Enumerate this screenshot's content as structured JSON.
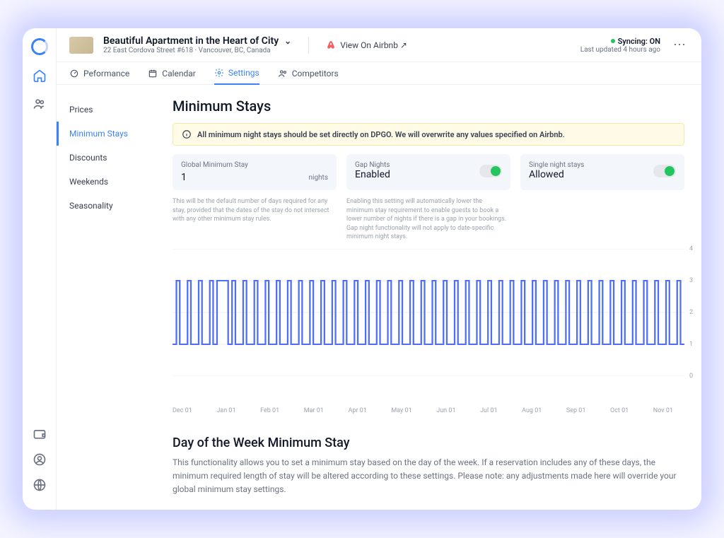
{
  "header": {
    "title": "Beautiful Apartment in the Heart of City",
    "subtitle": "22 East Cordova Street #618 · Vancouver, BC, Canada",
    "view_on": "View On Airbnb ↗",
    "sync_label": "Syncing: ON",
    "last_updated": "Last updated 4 hours ago"
  },
  "tabs": {
    "performance": "Peformance",
    "calendar": "Calendar",
    "settings": "Settings",
    "competitors": "Competitors"
  },
  "sidebar": {
    "items": [
      "Prices",
      "Minimum Stays",
      "Discounts",
      "Weekends",
      "Seasonality"
    ]
  },
  "page": {
    "title": "Minimum Stays",
    "alert": "All minimum night stays should be set directly on DPGO. We will overwrite any values specified on Airbnb."
  },
  "cards": {
    "global": {
      "label": "Global Minimum Stay",
      "value": "1",
      "unit": "nights",
      "help": "This will be the default number of days required for any stay, provided that the dates of the stay do not intersect with any other minimum stay rules."
    },
    "gap": {
      "label": "Gap Nights",
      "value": "Enabled",
      "help": "Enabling this setting will automatically lower the minimum stay requirement to enable guests to book a lower number of nights if there is a gap in your bookings. Gap night functionality will not apply to date-specific minimum night stays."
    },
    "single": {
      "label": "Single night stays",
      "value": "Allowed"
    }
  },
  "chart_data": {
    "type": "line",
    "title": "",
    "xlabel": "",
    "ylabel": "",
    "ylim": [
      0,
      4
    ],
    "y_ticks": [
      0,
      1,
      2,
      3,
      4
    ],
    "x_ticks": [
      "Dec 01",
      "Jan 01",
      "Feb 01",
      "Mar 01",
      "Apr 01",
      "May 01",
      "Jun 01",
      "Jul 01",
      "Aug 01",
      "Sep 01",
      "Oct 01",
      "Nov 01"
    ],
    "pattern": "Weekly oscillation between 1 and 3 nights; a single plateau of value 3 for approximately one week in late December.",
    "approx_values_by_week": [
      {
        "week": "Nov wk4",
        "min": 1,
        "max": 3
      },
      {
        "week": "Dec wk1",
        "min": 1,
        "max": 3
      },
      {
        "week": "Dec wk2",
        "min": 1,
        "max": 3
      },
      {
        "week": "Dec wk3",
        "min": 1,
        "max": 3
      },
      {
        "week": "Dec wk4",
        "min": 3,
        "max": 3
      },
      {
        "week": "Jan wk1",
        "min": 1,
        "max": 3
      },
      {
        "week": "Jan wk2",
        "min": 1,
        "max": 3
      },
      {
        "week": "Jan wk3",
        "min": 1,
        "max": 3
      },
      {
        "week": "Jan wk4",
        "min": 1,
        "max": 3
      },
      {
        "week": "Feb wk1",
        "min": 1,
        "max": 3
      },
      {
        "week": "Feb wk2",
        "min": 1,
        "max": 3
      },
      {
        "week": "Feb wk3",
        "min": 1,
        "max": 3
      },
      {
        "week": "Feb wk4",
        "min": 1,
        "max": 3
      },
      {
        "week": "Mar wk1",
        "min": 1,
        "max": 3
      },
      {
        "week": "Mar wk2",
        "min": 1,
        "max": 3
      },
      {
        "week": "Mar wk3",
        "min": 1,
        "max": 3
      },
      {
        "week": "Mar wk4",
        "min": 1,
        "max": 3
      },
      {
        "week": "Apr wk1",
        "min": 1,
        "max": 3
      },
      {
        "week": "Apr wk2",
        "min": 1,
        "max": 3
      },
      {
        "week": "Apr wk3",
        "min": 1,
        "max": 3
      },
      {
        "week": "Apr wk4",
        "min": 1,
        "max": 3
      },
      {
        "week": "May wk1",
        "min": 1,
        "max": 3
      },
      {
        "week": "May wk2",
        "min": 1,
        "max": 3
      },
      {
        "week": "May wk3",
        "min": 1,
        "max": 3
      },
      {
        "week": "May wk4",
        "min": 1,
        "max": 3
      },
      {
        "week": "Jun wk1",
        "min": 1,
        "max": 3
      },
      {
        "week": "Jun wk2",
        "min": 1,
        "max": 3
      },
      {
        "week": "Jun wk3",
        "min": 1,
        "max": 3
      },
      {
        "week": "Jun wk4",
        "min": 1,
        "max": 3
      },
      {
        "week": "Jul wk1",
        "min": 1,
        "max": 3
      },
      {
        "week": "Jul wk2",
        "min": 1,
        "max": 3
      },
      {
        "week": "Jul wk3",
        "min": 1,
        "max": 3
      },
      {
        "week": "Jul wk4",
        "min": 1,
        "max": 3
      },
      {
        "week": "Aug wk1",
        "min": 1,
        "max": 3
      },
      {
        "week": "Aug wk2",
        "min": 1,
        "max": 3
      },
      {
        "week": "Aug wk3",
        "min": 1,
        "max": 3
      },
      {
        "week": "Aug wk4",
        "min": 1,
        "max": 3
      },
      {
        "week": "Sep wk1",
        "min": 1,
        "max": 3
      },
      {
        "week": "Sep wk2",
        "min": 1,
        "max": 3
      },
      {
        "week": "Sep wk3",
        "min": 1,
        "max": 3
      },
      {
        "week": "Sep wk4",
        "min": 1,
        "max": 3
      },
      {
        "week": "Oct wk1",
        "min": 1,
        "max": 3
      },
      {
        "week": "Oct wk2",
        "min": 1,
        "max": 3
      },
      {
        "week": "Oct wk3",
        "min": 1,
        "max": 3
      },
      {
        "week": "Oct wk4",
        "min": 1,
        "max": 3
      },
      {
        "week": "Nov wk1",
        "min": 1,
        "max": 3
      }
    ]
  },
  "dow": {
    "title": "Day of the Week Minimum Stay",
    "desc": "This functionality allows you to set a minimum stay based on the day of the week. If a reservation includes any of these days, the minimum required length of stay will be altered according to these settings. Please note: any adjustments made here will override your global minimum stay settings."
  }
}
